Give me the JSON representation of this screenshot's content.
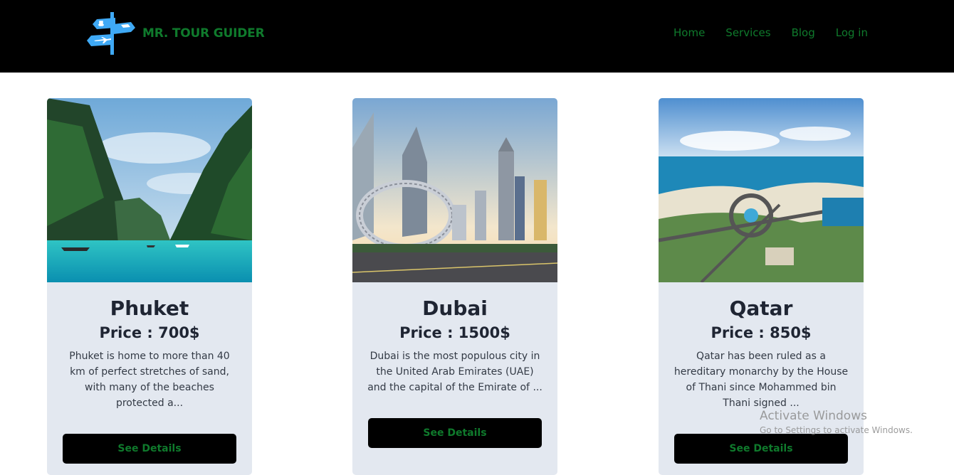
{
  "header": {
    "brand": "MR. TOUR GUIDER",
    "nav": [
      "Home",
      "Services",
      "Blog",
      "Log in"
    ]
  },
  "cards": [
    {
      "title": "Phuket",
      "price": "Price : 700$",
      "description": "Phuket is home to more than 40 km of perfect stretches of sand, with many of the beaches protected a...",
      "button": "See Details"
    },
    {
      "title": "Dubai",
      "price": "Price : 1500$",
      "description": "Dubai is the most populous city in the United Arab Emirates (UAE) and the capital of the Emirate of ...",
      "button": "See Details"
    },
    {
      "title": "Qatar",
      "price": "Price : 850$",
      "description": "Qatar has been ruled as a hereditary monarchy by the House of Thani since Mohammed bin Thani signed ...",
      "button": "See Details"
    }
  ],
  "watermark": {
    "title": "Activate Windows",
    "subtitle": "Go to Settings to activate Windows."
  },
  "colors": {
    "header_bg": "#000000",
    "accent_green": "#0f7a2c",
    "card_bg": "#e3e8f0"
  }
}
